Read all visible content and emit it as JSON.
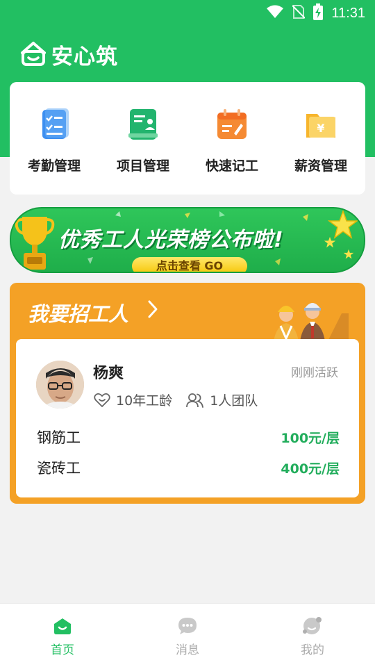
{
  "status_bar": {
    "time": "11:31"
  },
  "brand": {
    "name": "安心筑"
  },
  "quick_actions": [
    {
      "label": "考勤管理",
      "icon": "attendance-icon",
      "color": "#3d8ff0"
    },
    {
      "label": "项目管理",
      "icon": "project-icon",
      "color": "#22b46e"
    },
    {
      "label": "快速记工",
      "icon": "quick-record-icon",
      "color": "#f58a33"
    },
    {
      "label": "薪资管理",
      "icon": "salary-icon",
      "color": "#f7b52c"
    }
  ],
  "banner": {
    "title": "优秀工人光荣榜公布啦!",
    "button": "点击查看 GO"
  },
  "recruit": {
    "title": "我要招工人",
    "worker": {
      "name": "杨爽",
      "status": "刚刚活跃",
      "experience": "10年工龄",
      "team": "1人团队",
      "skills": [
        {
          "name": "钢筋工",
          "price": "100元/层"
        },
        {
          "name": "瓷砖工",
          "price": "400元/层"
        }
      ]
    }
  },
  "tabs": [
    {
      "label": "首页",
      "icon": "home-icon",
      "active": true
    },
    {
      "label": "消息",
      "icon": "message-icon",
      "active": false
    },
    {
      "label": "我的",
      "icon": "profile-icon",
      "active": false
    }
  ],
  "colors": {
    "primary": "#22bf62",
    "accent_orange": "#f4a126",
    "price_green": "#22ad5c"
  }
}
